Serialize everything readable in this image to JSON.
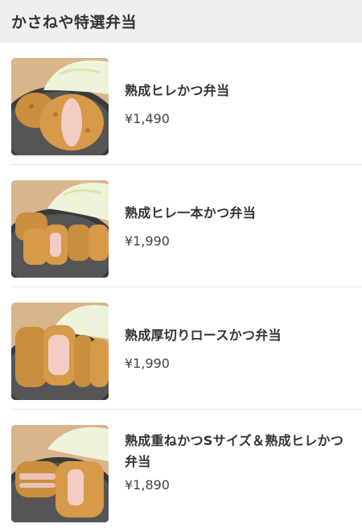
{
  "header": {
    "title": "かさねや特選弁当"
  },
  "items": [
    {
      "name": "熟成ヒレかつ弁当",
      "price": "¥1,490",
      "image": "hire-katsu-photo"
    },
    {
      "name": "熟成ヒレ一本かつ弁当",
      "price": "¥1,990",
      "image": "hire-ippon-katsu-photo"
    },
    {
      "name": "熟成厚切りロースかつ弁当",
      "price": "¥1,990",
      "image": "atsugiri-rosu-katsu-photo"
    },
    {
      "name": "熟成重ねかつSサイズ＆熟成ヒレかつ弁当",
      "price": "¥1,890",
      "image": "kasane-katsu-photo"
    }
  ],
  "colors": {
    "header_bg": "#efefef",
    "title_text": "#333333",
    "divider": "#e6e6e6"
  }
}
